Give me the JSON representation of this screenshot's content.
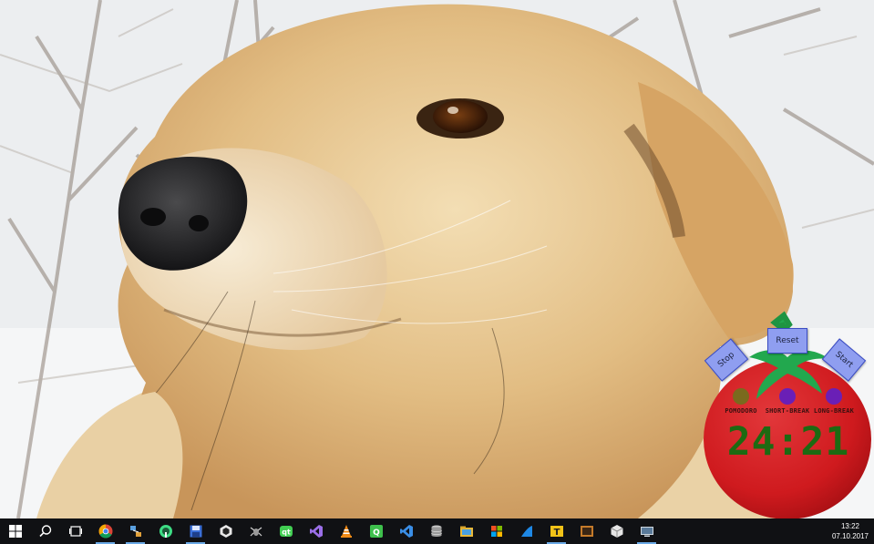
{
  "window": {
    "title": "Windows 10 desktop"
  },
  "pomodoro": {
    "buttons": {
      "stop": "Stop",
      "reset": "Reset",
      "start": "Start"
    },
    "modes": [
      {
        "label": "POMODORO",
        "color": "#7a6a1e"
      },
      {
        "label": "SHORT-BREAK",
        "color": "#6a1fb6"
      },
      {
        "label": "LONG-BREAK",
        "color": "#6a1fb6"
      }
    ],
    "timer": "24:21",
    "colors": {
      "tomato": "#d7191c",
      "leaves": "#1ea54a",
      "timer_text": "#1d6a12",
      "button": "#8f9ef0"
    }
  },
  "taskbar": {
    "icons": [
      "windows-start-icon",
      "search-icon",
      "task-view-icon",
      "chrome-icon",
      "network-app-icon",
      "android-studio-icon",
      "save-app-icon",
      "unity-icon",
      "insect-app-icon",
      "qt-creator-icon",
      "visual-studio-icon",
      "vlc-icon",
      "qt-icon",
      "vscode-icon",
      "database-icon",
      "file-explorer-icon",
      "windows-flag-app-icon",
      "blue-app-icon",
      "text-app-icon",
      "media-app-icon",
      "cube-app-icon",
      "screen-app-icon"
    ],
    "clock": {
      "time": "13:22",
      "date": "07.10.2017"
    }
  }
}
